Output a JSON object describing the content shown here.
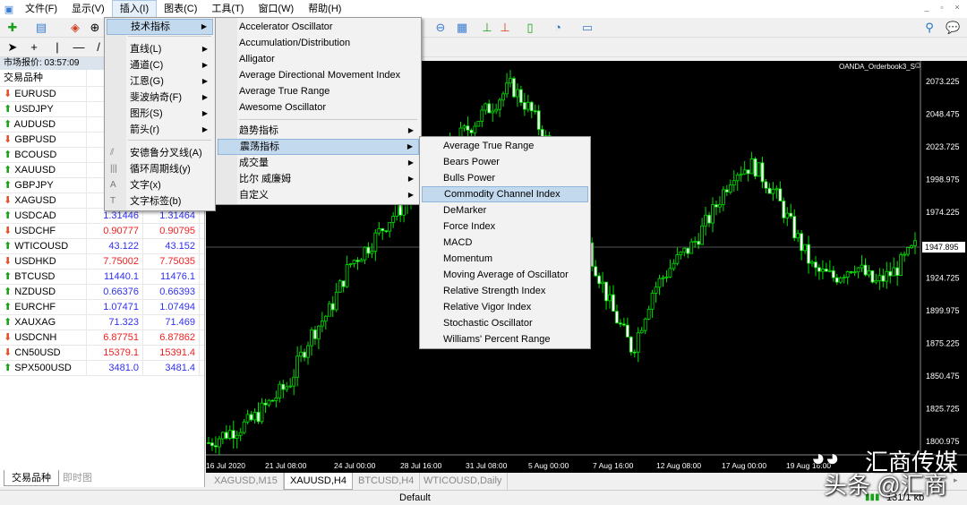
{
  "menubar": {
    "items": [
      "文件(F)",
      "显示(V)",
      "插入(I)",
      "图表(C)",
      "工具(T)",
      "窗口(W)",
      "帮助(H)"
    ]
  },
  "market_watch": {
    "title": "市场报价: 03:57:09",
    "column_symbol": "交易品种",
    "rows": [
      {
        "symbol": "EURUSD",
        "dir": "down",
        "bid": "",
        "ask": ""
      },
      {
        "symbol": "USDJPY",
        "dir": "up",
        "bid": "",
        "ask": ""
      },
      {
        "symbol": "AUDUSD",
        "dir": "up",
        "bid": "",
        "ask": ""
      },
      {
        "symbol": "GBPUSD",
        "dir": "down",
        "bid": "",
        "ask": ""
      },
      {
        "symbol": "BCOUSD",
        "dir": "up",
        "bid": "",
        "ask": ""
      },
      {
        "symbol": "XAUUSD",
        "dir": "up",
        "bid": "",
        "ask": ""
      },
      {
        "symbol": "GBPJPY",
        "dir": "up",
        "bid": "",
        "ask": ""
      },
      {
        "symbol": "XAGUSD",
        "dir": "down",
        "bid": "",
        "ask": ""
      },
      {
        "symbol": "USDCAD",
        "dir": "up",
        "bid": "1.31446",
        "ask": "1.31464"
      },
      {
        "symbol": "USDCHF",
        "dir": "down",
        "bid": "0.90777",
        "ask": "0.90795"
      },
      {
        "symbol": "WTICOUSD",
        "dir": "up",
        "bid": "43.122",
        "ask": "43.152"
      },
      {
        "symbol": "USDHKD",
        "dir": "down",
        "bid": "7.75002",
        "ask": "7.75035"
      },
      {
        "symbol": "BTCUSD",
        "dir": "up",
        "bid": "11440.1",
        "ask": "11476.1"
      },
      {
        "symbol": "NZDUSD",
        "dir": "up",
        "bid": "0.66376",
        "ask": "0.66393"
      },
      {
        "symbol": "EURCHF",
        "dir": "up",
        "bid": "1.07471",
        "ask": "1.07494"
      },
      {
        "symbol": "XAUXAG",
        "dir": "up",
        "bid": "71.323",
        "ask": "71.469"
      },
      {
        "symbol": "USDCNH",
        "dir": "down",
        "bid": "6.87751",
        "ask": "6.87862"
      },
      {
        "symbol": "CN50USD",
        "dir": "down",
        "bid": "15379.1",
        "ask": "15391.4"
      },
      {
        "symbol": "SPX500USD",
        "dir": "up",
        "bid": "3481.0",
        "ask": "3481.4"
      }
    ],
    "tabs": [
      "交易品种",
      "即时图"
    ]
  },
  "insert_menu": {
    "items": [
      {
        "label": "技术指标",
        "submenu": true,
        "highlighted": true
      },
      {
        "label": "直线(L)",
        "submenu": true
      },
      {
        "label": "通道(C)",
        "submenu": true
      },
      {
        "label": "江恩(G)",
        "submenu": true
      },
      {
        "label": "斐波纳奇(F)",
        "submenu": true
      },
      {
        "label": "图形(S)",
        "submenu": true
      },
      {
        "label": "箭头(r)",
        "submenu": true
      },
      {
        "label": "安德鲁分叉线(A)",
        "icon": "andrews-pitchfork-icon"
      },
      {
        "label": "循环周期线(y)",
        "icon": "cycle-lines-icon"
      },
      {
        "label": "文字(x)",
        "icon": "text-icon"
      },
      {
        "label": "文字标签(b)",
        "icon": "text-label-icon"
      }
    ]
  },
  "indicators_menu": {
    "items": [
      "Accelerator Oscillator",
      "Accumulation/Distribution",
      "Alligator",
      "Average Directional Movement Index",
      "Average True Range",
      "Awesome Oscillator"
    ],
    "groups": [
      {
        "label": "趋势指标"
      },
      {
        "label": "震荡指标",
        "highlighted": true
      },
      {
        "label": "成交量"
      },
      {
        "label": "比尔 威廉姆"
      },
      {
        "label": "自定义"
      }
    ]
  },
  "oscillators_menu": {
    "items": [
      "Average True Range",
      "Bears Power",
      "Bulls Power",
      "Commodity Channel Index",
      "DeMarker",
      "Force Index",
      "MACD",
      "Momentum",
      "Moving Average of Oscillator",
      "Relative Strength Index",
      "Relative Vigor Index",
      "Stochastic Oscillator",
      "Williams' Percent Range"
    ],
    "highlighted": "Commodity Channel Index"
  },
  "chart": {
    "indicator_label": "OANDA_Orderbook3_S",
    "price_ticks": [
      "2073.225",
      "2048.475",
      "2023.725",
      "1998.975",
      "1974.225",
      "1924.725",
      "1899.975",
      "1875.225",
      "1850.475",
      "1825.725",
      "1800.975"
    ],
    "current_price": "1947.895",
    "time_ticks": [
      "16 Jul 2020",
      "21 Jul 08:00",
      "24 Jul 00:00",
      "28 Jul 16:00",
      "31 Jul 08:00",
      "5 Aug 00:00",
      "7 Aug 16:00",
      "12 Aug 08:00",
      "17 Aug 00:00",
      "19 Aug 16:00"
    ],
    "price_path": [
      1800,
      1808,
      1815,
      1830,
      1845,
      1880,
      1900,
      1935,
      1950,
      1970,
      1985,
      2000,
      2025,
      2040,
      2055,
      2070,
      2050,
      2020,
      1990,
      1940,
      1900,
      1870,
      1915,
      1935,
      1950,
      1975,
      2005,
      2010,
      1990,
      1960,
      1930,
      1925,
      1935,
      1920,
      1930,
      1948
    ],
    "bull_color": "#00e000",
    "bear_color": "#ffffff",
    "background": "#000000"
  },
  "chart_tabs": [
    {
      "label": "XAGUSD,M15"
    },
    {
      "label": "XAUUSD,H4",
      "active": true
    },
    {
      "label": "BTCUSD,H4"
    },
    {
      "label": "WTICOUSD,Daily"
    }
  ],
  "status": {
    "profile": "Default",
    "traffic": "131/1 kb"
  },
  "watermark": {
    "line1": "汇商传媒",
    "line2": "头条 @汇商"
  }
}
